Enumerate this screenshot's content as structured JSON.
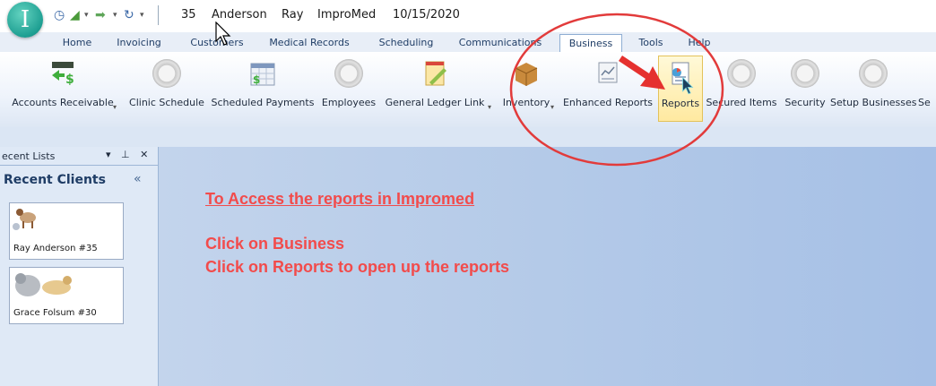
{
  "title_bar": {
    "app_letter": "I",
    "record_number": "35",
    "last_name": "Anderson",
    "first_name": "Ray",
    "app_name": "ImproMed",
    "date": "10/15/2020"
  },
  "tabs": [
    "Home",
    "Invoicing",
    "Customers",
    "Medical Records",
    "Scheduling",
    "Communications",
    "Business",
    "Tools",
    "Help"
  ],
  "active_tab": "Business",
  "ribbon": {
    "accounts_receivable": "Accounts Receivable",
    "clinic_schedule": "Clinic Schedule",
    "scheduled_payments": "Scheduled Payments",
    "employees": "Employees",
    "general_ledger_link": "General Ledger Link",
    "inventory": "Inventory",
    "enhanced_reports": "Enhanced Reports",
    "reports": "Reports",
    "secured_items": "Secured Items",
    "security": "Security",
    "setup_businesses": "Setup Businesses",
    "cut_off": "Se"
  },
  "left_panel": {
    "header": "ecent Lists",
    "header_buttons": "▾ ⊥ ✕",
    "section_title": "Recent Clients",
    "collapse_glyph": "«",
    "clients": [
      "Ray Anderson #35",
      "Grace Folsum #30"
    ]
  },
  "instructions": {
    "title": "To Access the reports in Impromed",
    "line1": "Click on Business",
    "line2": "Click on Reports to open up the reports"
  },
  "colors": {
    "annotation_red": "#f24b4b",
    "ribbon_highlight": "#ffe9a0",
    "workspace_blue": "#b4cae8"
  }
}
